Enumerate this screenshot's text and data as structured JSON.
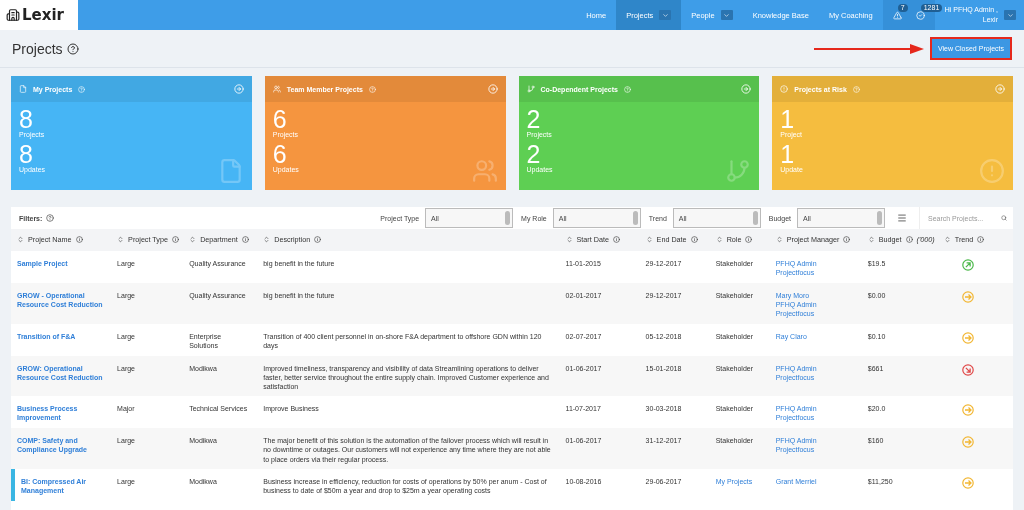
{
  "header": {
    "logo": "Lexir",
    "nav": [
      {
        "label": "Home",
        "selected": false,
        "dropdown": false
      },
      {
        "label": "Projects",
        "selected": true,
        "dropdown": true
      },
      {
        "label": "People",
        "selected": false,
        "dropdown": true
      },
      {
        "label": "Knowledge Base",
        "selected": false,
        "dropdown": false
      },
      {
        "label": "My Coaching",
        "selected": false,
        "dropdown": false
      }
    ],
    "alerts_badge": "7",
    "notifications_badge": "1281",
    "user_line_1": "Hi PFHQ Admin ,",
    "user_line_2": "Lexir"
  },
  "page": {
    "title": "Projects",
    "closed_button": "View Closed Projects"
  },
  "cards": [
    {
      "kind": "file",
      "title": "My Projects",
      "count": "8",
      "count_label": "Projects",
      "updates": "8",
      "updates_label": "Updates",
      "color": "#46b5f5"
    },
    {
      "kind": "team",
      "title": "Team Member Projects",
      "count": "6",
      "count_label": "Projects",
      "updates": "6",
      "updates_label": "Updates",
      "color": "#f5953f"
    },
    {
      "kind": "branch",
      "title": "Co-Dependent Projects",
      "count": "2",
      "count_label": "Projects",
      "updates": "2",
      "updates_label": "Updates",
      "color": "#5ecf53"
    },
    {
      "kind": "risk",
      "title": "Projects at Risk",
      "count": "1",
      "count_label": "Project",
      "updates": "1",
      "updates_label": "Update",
      "color": "#f5bd3f"
    }
  ],
  "filters": {
    "label": "Filters:",
    "selects": [
      {
        "label": "Project Type",
        "value": "All"
      },
      {
        "label": "My Role",
        "value": "All"
      },
      {
        "label": "Trend",
        "value": "All"
      },
      {
        "label": "Budget",
        "value": "All"
      }
    ],
    "search_placeholder": "Search Projects..."
  },
  "table": {
    "columns": [
      "Project Name",
      "Project Type",
      "Department",
      "Description",
      "Start Date",
      "End Date",
      "Role",
      "Project Manager",
      "Budget",
      "Trend"
    ],
    "budget_unit": "('000)",
    "rows": [
      {
        "name": "Sample Project",
        "type": "Large",
        "department": "Quality Assurance",
        "description": "big benefit in the future",
        "start": "11-01-2015",
        "end": "29-12-2017",
        "role": "Stakeholder",
        "role_link": false,
        "managers": [
          "PFHQ Admin",
          "Projectfocus"
        ],
        "budget": "$19.5",
        "trend": {
          "kind": "up"
        },
        "selected": false
      },
      {
        "name": "GROW - Operational Resource Cost Reduction",
        "type": "Large",
        "department": "Quality Assurance",
        "description": "big benefit in the future",
        "start": "02-01-2017",
        "end": "29-12-2017",
        "role": "Stakeholder",
        "role_link": false,
        "managers": [
          "Mary Moro",
          "PFHQ Admin",
          "Projectfocus"
        ],
        "budget": "$0.00",
        "trend": {
          "kind": "flat"
        },
        "selected": false
      },
      {
        "name": "Transition of F&A",
        "type": "Large",
        "department": "Enterprise Solutions",
        "description": "Transition of 400 client personnel in on-shore F&A department to offshore GDN within 120 days",
        "start": "02-07-2017",
        "end": "05-12-2018",
        "role": "Stakeholder",
        "role_link": false,
        "managers": [
          "Ray Claro"
        ],
        "budget": "$0.10",
        "trend": {
          "kind": "flat"
        },
        "selected": false
      },
      {
        "name": "GROW: Operational Resource Cost Reduction",
        "type": "Large",
        "department": "Modikwa",
        "description": "Improved timeliness, transparency and visibility of data Streamlining operations to deliver faster, better service throughout the entire supply chain. Improved Customer experience and satisfaction",
        "start": "01-06-2017",
        "end": "15-01-2018",
        "role": "Stakeholder",
        "role_link": false,
        "managers": [
          "PFHQ Admin",
          "Projectfocus"
        ],
        "budget": "$661",
        "trend": {
          "kind": "down"
        },
        "selected": false
      },
      {
        "name": "Business Process Improvement",
        "type": "Major",
        "department": "Technical Services",
        "description": "Improve Business",
        "start": "11-07-2017",
        "end": "30-03-2018",
        "role": "Stakeholder",
        "role_link": false,
        "managers": [
          "PFHQ Admin",
          "Projectfocus"
        ],
        "budget": "$20.0",
        "trend": {
          "kind": "flat"
        },
        "selected": false
      },
      {
        "name": "COMP: Safety and Compliance Upgrade",
        "type": "Large",
        "department": "Modikwa",
        "description": "The major benefit of this solution is the automation of the failover process which will result in no downtime or outages. Our customers will not experience any time where they are not able to place orders via their regular process.",
        "start": "01-06-2017",
        "end": "31-12-2017",
        "role": "Stakeholder",
        "role_link": false,
        "managers": [
          "PFHQ Admin",
          "Projectfocus"
        ],
        "budget": "$160",
        "trend": {
          "kind": "flat"
        },
        "selected": false
      },
      {
        "name": "BI: Compressed Air Management",
        "type": "Large",
        "department": "Modikwa",
        "description": "Business increase in efficiency, reduction for costs of operations by 50% per anum - Cost of business to date of $50m a year and drop to $25m a year operating costs",
        "start": "10-08-2016",
        "end": "29-06-2017",
        "role": "My Projects",
        "role_link": true,
        "managers": [
          "Grant Merriel"
        ],
        "budget": "$11,250",
        "trend": {
          "kind": "flat"
        },
        "selected": true
      }
    ]
  }
}
